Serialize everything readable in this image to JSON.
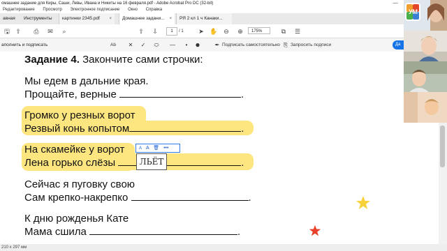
{
  "window": {
    "title": "омашнее задание для Киры, Саши, Левы, Ивана и Никиты на 16 февраля.pdf - Adobe Acrobat Pro DC (32-bit)",
    "minimize": "—"
  },
  "menu": [
    "",
    "Редактирование",
    "Просмотр",
    "Электронное подписание",
    "Окно",
    "Справка"
  ],
  "tabs": {
    "home": "авная",
    "tools": "Инструменты",
    "doc1": "картинки 2345.pdf",
    "doc2": "Домашнее задани...",
    "doc3": "РЯ 2 кл 1 ч Канаки...",
    "close": "×"
  },
  "toolbar": {
    "page_current": "1",
    "page_total": "/ 1",
    "zoom": "175%"
  },
  "fillsign": {
    "label": "аполнить и подписать",
    "text_tool": "Ab",
    "sign_self": "Подписать самостоятельно",
    "request_sigs": "Запросить подписи",
    "next_button": "Да"
  },
  "document": {
    "title_bold": "Задание 4.",
    "title_rest": " Закончите сами строчки:",
    "stanza1_line1": "Мы едем в дальние края.",
    "stanza1_line2": "Прощайте, верные ",
    "stanza2_line1": "Громко у резных ворот",
    "stanza2_line2": "Резвый конь копытом",
    "stanza3_line1": "На скамейке у ворот",
    "stanza3_line2": "Лена горько слёзы ",
    "stanza4_line1": "Сейчас я пуговку свою",
    "stanza4_line2": "Сам крепко-накрепко ",
    "stanza5_line1": "К дню рожденья Кате",
    "stanza5_line2": "Мама сшила ",
    "period": ".",
    "typed_answer": "ЛЬЁТ"
  },
  "annotation_toolbar": {
    "small_a": "A",
    "large_a": "A",
    "delete": "🗑",
    "more": "•••"
  },
  "status": {
    "page_size": "210 x 297 мм"
  },
  "video_panel": {
    "logo_letters": "УМ"
  },
  "colors": {
    "highlight": "#fde680",
    "accent": "#1473e6",
    "star_yellow": "#f7d23a",
    "star_red": "#e8402a"
  }
}
